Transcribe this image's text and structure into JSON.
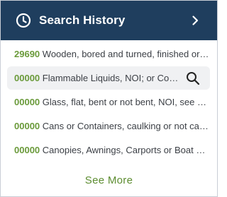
{
  "header": {
    "title": "Search History",
    "icon": "clock-icon",
    "action_icon": "chevron-right-icon",
    "background": "#1f3e5e"
  },
  "history": [
    {
      "code": "29690",
      "description": "Wooden, bored and turned, finished or unfinished"
    },
    {
      "code": "00000",
      "description": "Flammable Liquids, NOI; or Combustible Liquids"
    },
    {
      "code": "00000",
      "description": "Glass, flat, bent or not bent, NOI, see Note"
    },
    {
      "code": "00000",
      "description": "Cans or Containers, caulking or not caulking"
    },
    {
      "code": "00000",
      "description": "Canopies, Awnings, Carports or Boat Shelters"
    }
  ],
  "hovered_row_action_icon": "search-icon",
  "see_more_label": "See More",
  "colors": {
    "code": "#6a9a3a",
    "link": "#5d8d31",
    "text": "#3b3f45"
  }
}
